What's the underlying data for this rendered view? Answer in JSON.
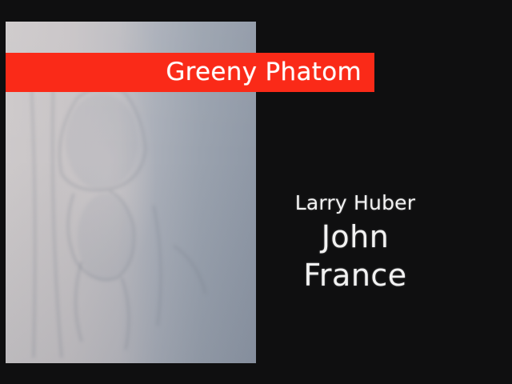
{
  "title": "Greeny Phatom",
  "credits": {
    "line1": "Larry Huber",
    "line2": "John",
    "line3": "France"
  },
  "colors": {
    "background": "#0f0f10",
    "banner": "#fa2a18",
    "text": "#ffffff"
  }
}
